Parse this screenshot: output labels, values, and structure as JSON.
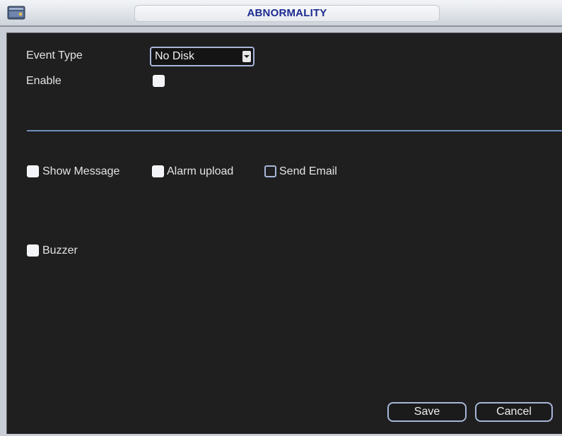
{
  "window": {
    "title": "ABNORMALITY",
    "icon": "device-icon"
  },
  "event_type": {
    "label": "Event Type",
    "value": "No Disk"
  },
  "enable": {
    "label": "Enable",
    "checked": true
  },
  "options": [
    {
      "label": "Show Message",
      "checked": true
    },
    {
      "label": "Alarm upload",
      "checked": true
    },
    {
      "label": "Send Email",
      "checked": false
    }
  ],
  "buzzer": {
    "label": "Buzzer",
    "checked": true
  },
  "buttons": {
    "save": "Save",
    "cancel": "Cancel"
  },
  "colors": {
    "title_text": "#1c2b8f",
    "panel_bg": "#1f1f20",
    "accent_border": "#a8b6d8"
  }
}
